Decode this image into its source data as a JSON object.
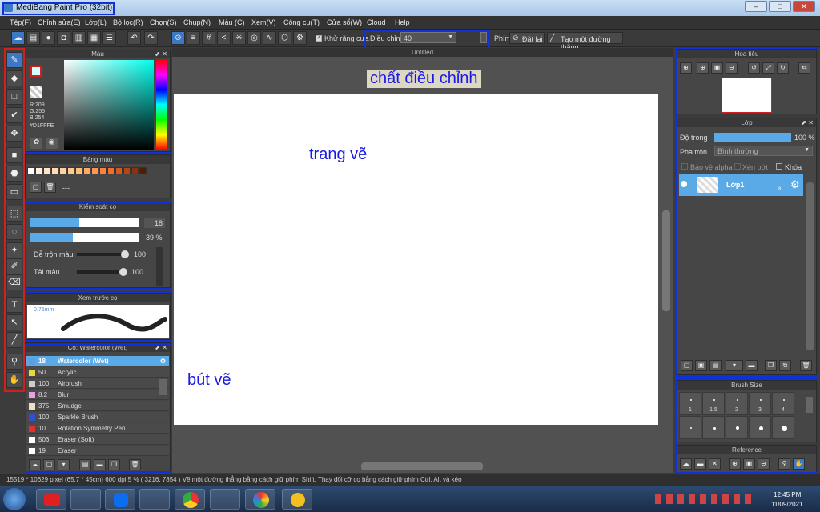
{
  "window": {
    "title": "MediBang Paint Pro (32bit)",
    "min": "–",
    "max": "□",
    "close": "✕"
  },
  "menu": [
    "Tệp(F)",
    "Chỉnh sửa(E)",
    "Lớp(L)",
    "Bộ lọc(R)",
    "Chọn(S)",
    "Chụp(N)",
    "Màu (C)",
    "Xem(V)",
    "Công cụ(T)",
    "Cửa sổ(W)",
    "Cloud",
    "Help"
  ],
  "toolbar": {
    "antialias": "Khử răng cưa",
    "correction_label": "Điều chỉnh",
    "correction_value": "40",
    "key_label": "Phím",
    "reset": "Đặt lại",
    "straight_line": "Tạo một đường thẳng"
  },
  "canvas_tab": "Untitled",
  "color_panel": {
    "title": "Màu",
    "r": "R:209",
    "g": "G:255",
    "b": "B:254",
    "hex": "#D1FFFE",
    "current_color": "#D1FFFE"
  },
  "palette_panel": {
    "title": "Bảng màu",
    "dash": "---",
    "swatches": [
      "#ffffff",
      "#fff0dc",
      "#ffe6c8",
      "#ffdcb4",
      "#ffd2a0",
      "#ffc88c",
      "#ffbe78",
      "#ffaa64",
      "#ff9650",
      "#ff823c",
      "#f06e28",
      "#d25a1e",
      "#b44614",
      "#8c320a",
      "#501e00"
    ]
  },
  "brush_control": {
    "title": "Kiểm soát cọ",
    "size": "18",
    "opacity": "39 %",
    "size_fraction": 0.45,
    "opacity_fraction": 0.39,
    "blend_label": "Dễ trộn màu",
    "blend_value": "100",
    "blend_fraction": 1.0,
    "reload_label": "Tải màu",
    "reload_value": "100",
    "reload_fraction": 1.0
  },
  "brush_preview": {
    "title": "Xem trước cọ",
    "size": "0.76mm"
  },
  "brush_list": {
    "title": "Cọ: Watercolor (Wet)",
    "items": [
      {
        "size": "18",
        "name": "Watercolor (Wet)",
        "color": "#5aa0e0",
        "selected": true
      },
      {
        "size": "50",
        "name": "Acrylic",
        "color": "#e8d840"
      },
      {
        "size": "100",
        "name": "Airbrush",
        "color": "#cccccc"
      },
      {
        "size": "8.2",
        "name": "Blur",
        "color": "#e8a0e0"
      },
      {
        "size": "375",
        "name": "Smudge",
        "color": "#e8e0c8"
      },
      {
        "size": "100",
        "name": "Sparkle Brush",
        "color": "#3050d0"
      },
      {
        "size": "10",
        "name": "Rotation Symmetry Pen",
        "color": "#e03030"
      },
      {
        "size": "506",
        "name": "Eraser (Soft)",
        "color": "#ffffff"
      },
      {
        "size": "19",
        "name": "Eraser",
        "color": "#ffffff"
      }
    ]
  },
  "annotations": {
    "canvas": "trang vẽ",
    "brush": "bút vẽ",
    "correction": "chất điều chỉnh"
  },
  "navigator": {
    "title": "Hoa tiêu"
  },
  "layer_panel": {
    "title": "Lớp",
    "opacity_label": "Độ trong",
    "opacity_value": "100 %",
    "opacity_fraction": 1.0,
    "blend_label": "Pha trộn",
    "blend_value": "Bình thường",
    "protect_alpha": "Bảo vệ alpha",
    "clipping": "Xén bớt",
    "lock": "Khóa",
    "layer_name": "Lớp1",
    "layer_count": "8"
  },
  "brush_size": {
    "title": "Brush Size",
    "labels": [
      "1",
      "1.5",
      "2",
      "3",
      "4"
    ]
  },
  "reference": {
    "title": "Reference"
  },
  "status": "15519 * 10629 pixel   (65.7 * 45cm)   600 dpi   5 %   ( 3216, 7854 )   Vẽ một đường thẳng bằng cách giữ phím Shift, Thay đổi cỡ cọ bằng cách giữ phím Ctrl, Alt và kéo",
  "clock": {
    "time": "12:45 PM",
    "date": "11/09/2021"
  },
  "taskbar_apps": [
    "start-orb",
    "youtube",
    "paint",
    "zalo",
    "files",
    "chrome",
    "settings",
    "medibang",
    "notes"
  ]
}
